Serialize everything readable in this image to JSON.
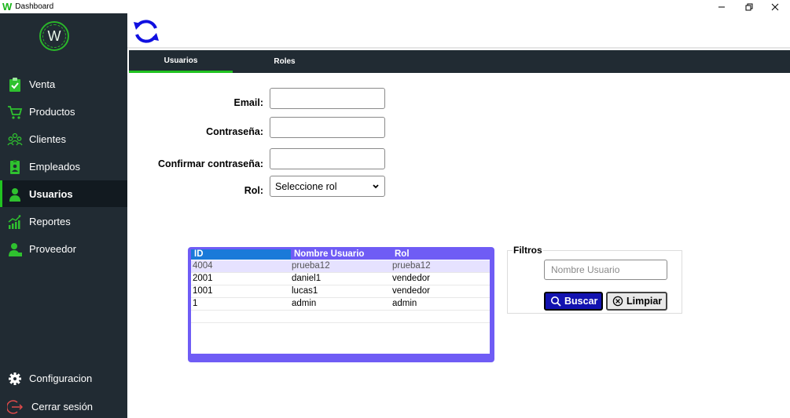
{
  "window": {
    "app_letter": "W",
    "title": "Dashboard"
  },
  "sidebar": {
    "logo_letter": "W",
    "items": [
      {
        "label": "Venta",
        "icon": "clipboard-check-icon"
      },
      {
        "label": "Productos",
        "icon": "shopping-cart-icon"
      },
      {
        "label": "Clientes",
        "icon": "users-group-icon"
      },
      {
        "label": "Empleados",
        "icon": "id-badge-icon"
      },
      {
        "label": "Usuarios",
        "icon": "user-icon",
        "active": true
      },
      {
        "label": "Reportes",
        "icon": "chart-growth-icon"
      },
      {
        "label": "Proveedor",
        "icon": "user-supplier-icon"
      }
    ],
    "bottom_items": [
      {
        "label": "Configuracion",
        "icon": "gear-icon"
      },
      {
        "label": "Cerrar sesión",
        "icon": "logout-icon"
      }
    ]
  },
  "tabs": [
    {
      "label": "Usuarios",
      "active": true
    },
    {
      "label": "Roles",
      "active": false
    }
  ],
  "form": {
    "email_label": "Email:",
    "email_value": "",
    "password_label": "Contraseña:",
    "password_value": "",
    "confirm_label": "Confirmar contraseña:",
    "confirm_value": "",
    "role_label": "Rol:",
    "role_selected": "Seleccione rol"
  },
  "table": {
    "headers": [
      "ID",
      "Nombre Usuario",
      "Rol"
    ],
    "rows": [
      [
        "4004",
        "prueba12",
        "prueba12"
      ],
      [
        "2001",
        "daniel1",
        "vendedor"
      ],
      [
        "1001",
        "lucas1",
        "vendedor"
      ],
      [
        "1",
        "admin",
        "admin"
      ]
    ]
  },
  "filters": {
    "title": "Filtros",
    "name_placeholder": "Nombre Usuario",
    "search_label": "Buscar",
    "clear_label": "Limpiar"
  },
  "colors": {
    "sidebar_bg": "#212b33",
    "accent_green": "#21c321",
    "table_purple": "#6f5cf5",
    "search_button": "#1212b0",
    "refresh_blue": "#1010e0"
  }
}
